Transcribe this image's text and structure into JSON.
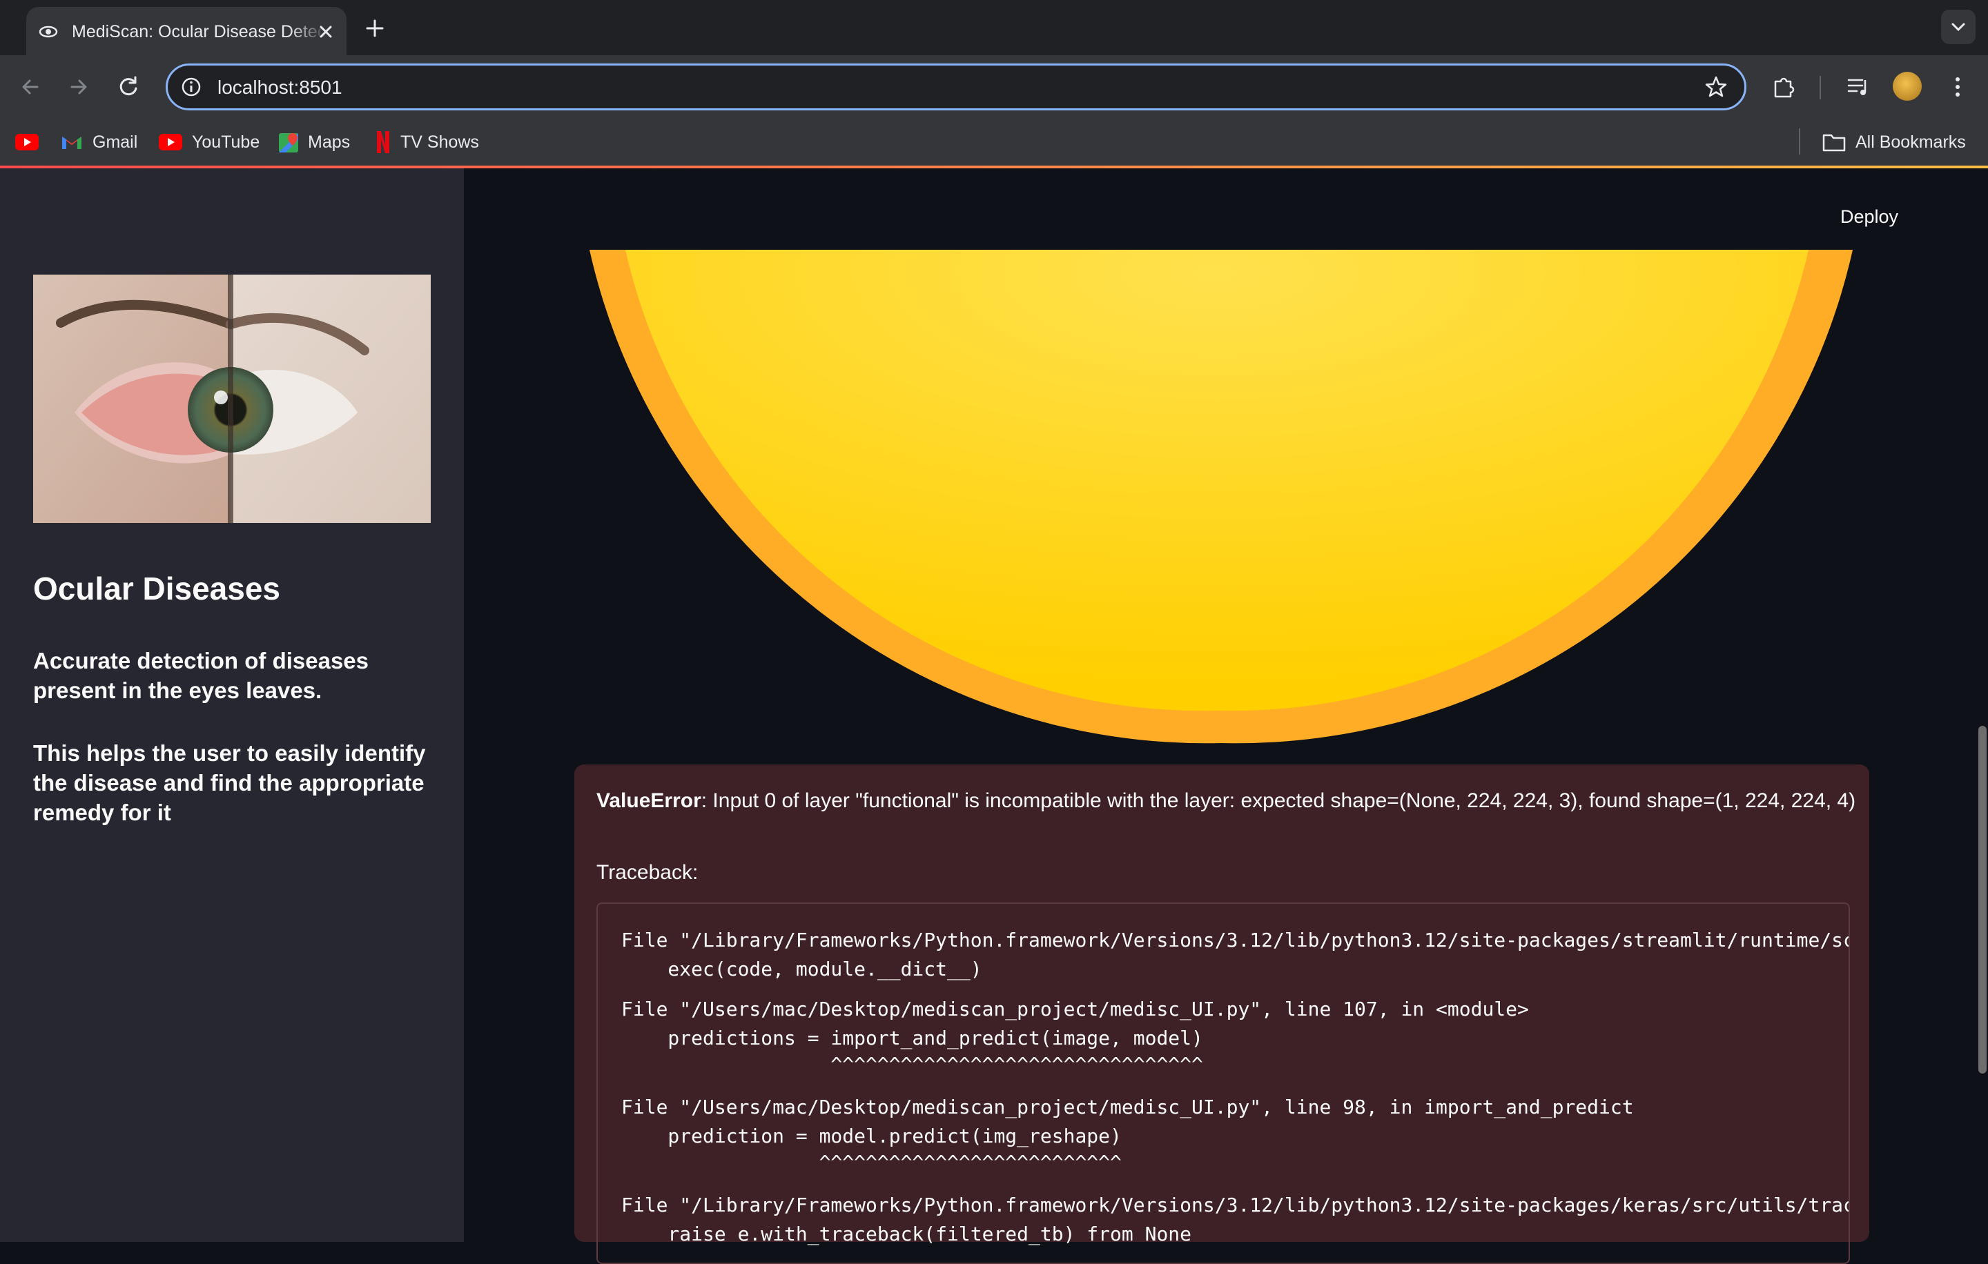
{
  "browser": {
    "tab_title": "MediScan: Ocular Disease Detection",
    "url": "localhost:8501",
    "bookmarks": [
      {
        "label": "",
        "icon": "youtube-icon"
      },
      {
        "label": "Gmail",
        "icon": "gmail-icon"
      },
      {
        "label": "YouTube",
        "icon": "youtube-icon"
      },
      {
        "label": "Maps",
        "icon": "maps-icon"
      },
      {
        "label": "TV Shows",
        "icon": "netflix-icon"
      }
    ],
    "all_bookmarks": "All Bookmarks"
  },
  "sidebar": {
    "image_alt": "Eye image",
    "title": "Ocular Diseases",
    "paragraph1": "Accurate detection of diseases present in the eyes leaves.",
    "paragraph2": "This helps the user to easily identify the disease and find the appropriate remedy for it"
  },
  "header": {
    "deploy_label": "Deploy"
  },
  "error": {
    "type": "ValueError",
    "message": ": Input 0 of layer \"functional\" is incompatible with the layer: expected shape=(None, 224, 224, 3), found shape=(1, 224, 224, 4)",
    "traceback_label": "Traceback:",
    "lines": [
      "File \"/Library/Frameworks/Python.framework/Versions/3.12/lib/python3.12/site-packages/streamlit/runtime/sc",
      "    exec(code, module.__dict__)",
      "File \"/Users/mac/Desktop/mediscan_project/medisc_UI.py\", line 107, in <module>",
      "    predictions = import_and_predict(image, model)",
      "                  ^^^^^^^^^^^^^^^^^^^^^^^^^^^^^^^^",
      "File \"/Users/mac/Desktop/mediscan_project/medisc_UI.py\", line 98, in import_and_predict",
      "    prediction = model.predict(img_reshape)",
      "                 ^^^^^^^^^^^^^^^^^^^^^^^^^^",
      "File \"/Library/Frameworks/Python.framework/Versions/3.12/lib/python3.12/site-packages/keras/src/utils/trac",
      "    raise e.with_traceback(filtered_tb) from None"
    ]
  },
  "colors": {
    "accent_red": "#ff4b4b",
    "sun_yellow": "#ffd21f",
    "sun_orange": "#ffb02e",
    "error_bg": "#3e2127"
  }
}
